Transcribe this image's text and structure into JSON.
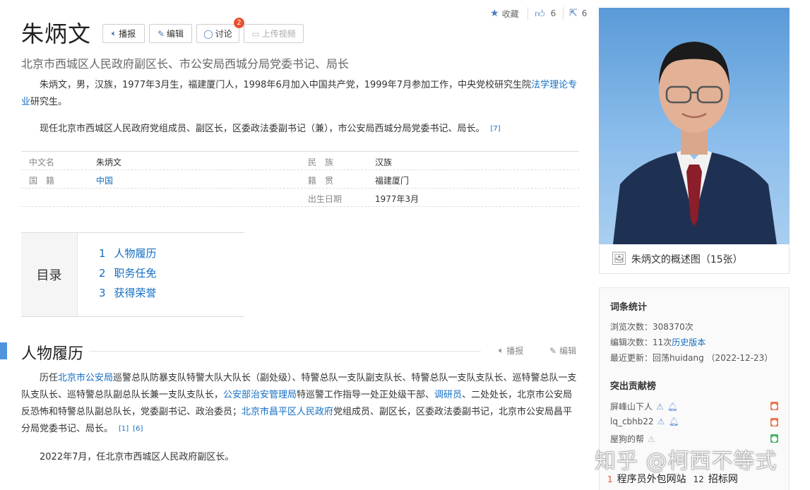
{
  "entry": {
    "title": "朱炳文",
    "buttons": {
      "broadcast": "播报",
      "edit": "编辑",
      "discuss": "讨论",
      "upload_video": "上传视频"
    },
    "discuss_badge": "2",
    "subtitle": "北京市西城区人民政府副区长、市公安局西城分局党委书记、局长"
  },
  "top_stats": {
    "favorite": "收藏",
    "likes": "6",
    "shares": "6"
  },
  "summary": {
    "p1_text": "朱炳文，男，汉族，1977年3月生，福建厦门人，1998年6月加入中国共产党，1999年7月参加工作，中央党校研究生院",
    "p1_link": "法学理论专业",
    "p1_tail": "研究生。",
    "p2_text": "现任北京市西城区人民政府党组成员、副区长，区委政法委副书记（兼），市公安局西城分局党委书记、局长。",
    "p2_ref": "[7]"
  },
  "infobox": {
    "rows": [
      {
        "k1": "中文名",
        "v1": "朱炳文",
        "k2": "民　族",
        "v2": "汉族"
      },
      {
        "k1": "国　籍",
        "v1": "中国",
        "k2": "籍　贯",
        "v2": "福建厦门"
      },
      {
        "k1": "",
        "v1": "",
        "k2": "出生日期",
        "v2": "1977年3月"
      }
    ]
  },
  "toc": {
    "label": "目录",
    "items": [
      {
        "num": "1",
        "label": "人物履历"
      },
      {
        "num": "2",
        "label": "职务任免"
      },
      {
        "num": "3",
        "label": "获得荣誉"
      }
    ]
  },
  "section": {
    "title": "人物履历",
    "broadcast": "播报",
    "edit": "编辑",
    "body_parts": [
      {
        "t": "历任",
        "link": false
      },
      {
        "t": "北京市公安局",
        "link": true
      },
      {
        "t": "巡警总队防暴支队特警大队大队长（副处级）、特警总队一支队副支队长、特警总队一支队支队长、巡特警总队一支队支队长、巡特警总队副总队长兼一支队支队长，",
        "link": false
      },
      {
        "t": "公安部治安管理局",
        "link": true
      },
      {
        "t": "特巡警工作指导一处正处级干部、",
        "link": false
      },
      {
        "t": "调研员",
        "link": true
      },
      {
        "t": "、二处处长，北京市公安局反恐怖和特警总队副总队长，党委副书记、政治委员；",
        "link": false
      },
      {
        "t": "北京市昌平区人民政府",
        "link": true
      },
      {
        "t": "党组成员、副区长，区委政法委副书记，北京市公安局昌平分局党委书记、局长。",
        "link": false
      }
    ],
    "refs": [
      "[1]",
      "[6]"
    ],
    "p2": "2022年7月，任北京市西城区人民政府副区长。"
  },
  "photo": {
    "caption": "朱炳文的概述图（15张）"
  },
  "stats": {
    "heading": "词条统计",
    "views": "浏览次数：308370次",
    "edits_prefix": "编辑次数：11次",
    "edits_link": "历史版本",
    "updated": "最近更新：回荡huidang （2022-12-23）",
    "contrib_heading": "突出贡献榜",
    "contributors": [
      "屏峰山下人",
      "lq_cbhb22",
      "屋狗的帮"
    ]
  },
  "watermark": "知乎 @柯西不等式",
  "bottom_links": [
    {
      "num": "1",
      "label": "程序员外包网站"
    },
    {
      "num": "12",
      "label": "招标网"
    }
  ],
  "colors": {
    "link": "#136ec2",
    "accent": "#4e93dc",
    "badge": "#e8502f"
  }
}
